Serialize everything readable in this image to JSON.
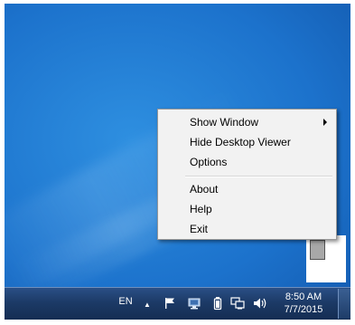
{
  "context_menu": {
    "items": [
      {
        "label": "Show Window",
        "has_submenu": true
      },
      {
        "label": "Hide Desktop Viewer"
      },
      {
        "label": "Options"
      },
      {
        "label": "About"
      },
      {
        "label": "Help"
      },
      {
        "label": "Exit"
      }
    ]
  },
  "taskbar": {
    "language": "EN",
    "tray_icons": [
      "chevron-up-icon",
      "flag-icon",
      "monitor-icon",
      "battery-icon",
      "network-icon",
      "volume-icon"
    ],
    "clock": {
      "time": "8:50 AM",
      "date": "7/7/2015"
    }
  },
  "colors": {
    "desktop": "#1c72cc",
    "taskbar": "#1c3a66",
    "menu_background": "#f2f2f2"
  }
}
